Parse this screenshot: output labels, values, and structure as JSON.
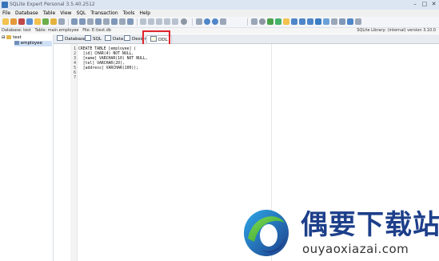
{
  "window": {
    "title": "SQLite Expert Personal 3.5.40.2512",
    "minimize": "–",
    "maximize": "□",
    "close": "✕"
  },
  "menu": [
    "File",
    "Database",
    "Table",
    "View",
    "SQL",
    "Transaction",
    "Tools",
    "Help"
  ],
  "infobar": {
    "database": "Database: test",
    "table": "Table: main.employee",
    "file": "File: E:\\test.db",
    "library": "SQLite Library: (internal) version 3.10.0"
  },
  "tree": {
    "root": "test",
    "child": "employee"
  },
  "tabs": [
    {
      "label": "Database"
    },
    {
      "label": "SQL"
    },
    {
      "label": "Data"
    },
    {
      "label": "Design"
    },
    {
      "label": "DDL"
    }
  ],
  "editor": {
    "line_numbers": [
      "1",
      "2",
      "3",
      "4",
      "5",
      "6",
      "7"
    ],
    "lines": [
      "CREATE TABLE [employee] (",
      "  [id] CHAR(4) NOT NULL,",
      "  [name] VARCHAR(10) NOT NULL,",
      "  [tel] VARCHAR(20),",
      "  [address] VARCHAR(100));",
      "",
      ""
    ]
  },
  "watermark": {
    "brand": "偶要下载站",
    "url": "ouyaoxiazai.com"
  },
  "colors": {
    "highlight_box": "#e0232b",
    "brand_blue": "#1d3f8a",
    "selection": "#cfe0f6"
  }
}
